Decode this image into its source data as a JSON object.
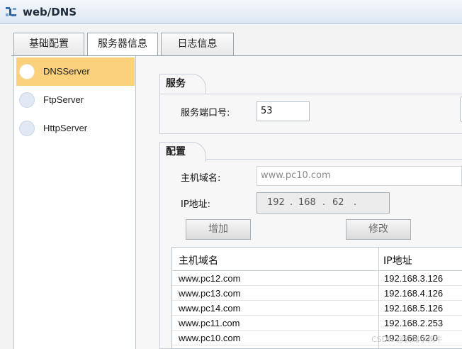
{
  "window": {
    "title": "web/DNS"
  },
  "tabs": [
    {
      "label": "基础配置",
      "active": false
    },
    {
      "label": "服务器信息",
      "active": true
    },
    {
      "label": "日志信息",
      "active": false
    }
  ],
  "sidebar": {
    "items": [
      {
        "label": "DNSServer",
        "selected": true
      },
      {
        "label": "FtpServer",
        "selected": false
      },
      {
        "label": "HttpServer",
        "selected": false
      }
    ]
  },
  "service": {
    "heading": "服务",
    "port_label": "服务端口号:",
    "port_value": "53"
  },
  "config": {
    "heading": "配置",
    "host_label": "主机域名:",
    "host_value": "www.pc10.com",
    "ip_label": "IP地址:",
    "ip_segments": [
      "192",
      "168",
      "62",
      ""
    ],
    "add_button": "增加",
    "edit_button": "修改"
  },
  "table": {
    "columns": [
      "主机域名",
      "IP地址"
    ],
    "rows": [
      {
        "host": "www.pc12.com",
        "ip": "192.168.3.126"
      },
      {
        "host": "www.pc13.com",
        "ip": "192.168.4.126"
      },
      {
        "host": "www.pc14.com",
        "ip": "192.168.5.126"
      },
      {
        "host": "www.pc11.com",
        "ip": "192.168.2.253"
      },
      {
        "host": "www.pc10.com",
        "ip": "192.168.62.0"
      }
    ]
  },
  "watermark": "CSDN @云端小狗牛",
  "colors": {
    "selected_item": "#fbd27b",
    "titlebar": "#dde7f1"
  },
  "icons": {
    "app": "dns-app-icon"
  }
}
